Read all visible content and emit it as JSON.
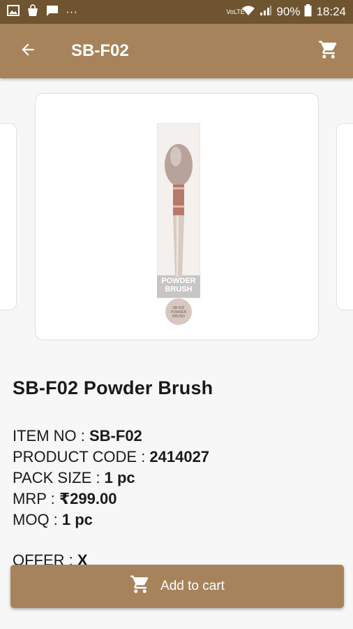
{
  "status_bar": {
    "battery": "90%",
    "time": "18:24",
    "network_label": "VoLTE",
    "dots": "···"
  },
  "app_bar": {
    "title": "SB-F02"
  },
  "product_image": {
    "package_text": "POWDER BRUSH",
    "sticker_text": "SB-F02 POWDER BRUSH"
  },
  "product": {
    "title": "SB-F02 Powder Brush",
    "specs": [
      {
        "label": "ITEM NO : ",
        "value": "SB-F02"
      },
      {
        "label": "PRODUCT CODE : ",
        "value": "2414027"
      },
      {
        "label": "PACK SIZE : ",
        "value": "1 pc"
      },
      {
        "label": "MRP : ",
        "value": "₹299.00"
      },
      {
        "label": "MOQ : ",
        "value": "1 pc"
      }
    ],
    "offer": {
      "label": "OFFER : ",
      "value": "X"
    }
  },
  "actions": {
    "add_to_cart": "Add to cart"
  },
  "colors": {
    "app_bar": "#a7835c",
    "status_bar": "#6f5430",
    "button": "#a7835c"
  }
}
